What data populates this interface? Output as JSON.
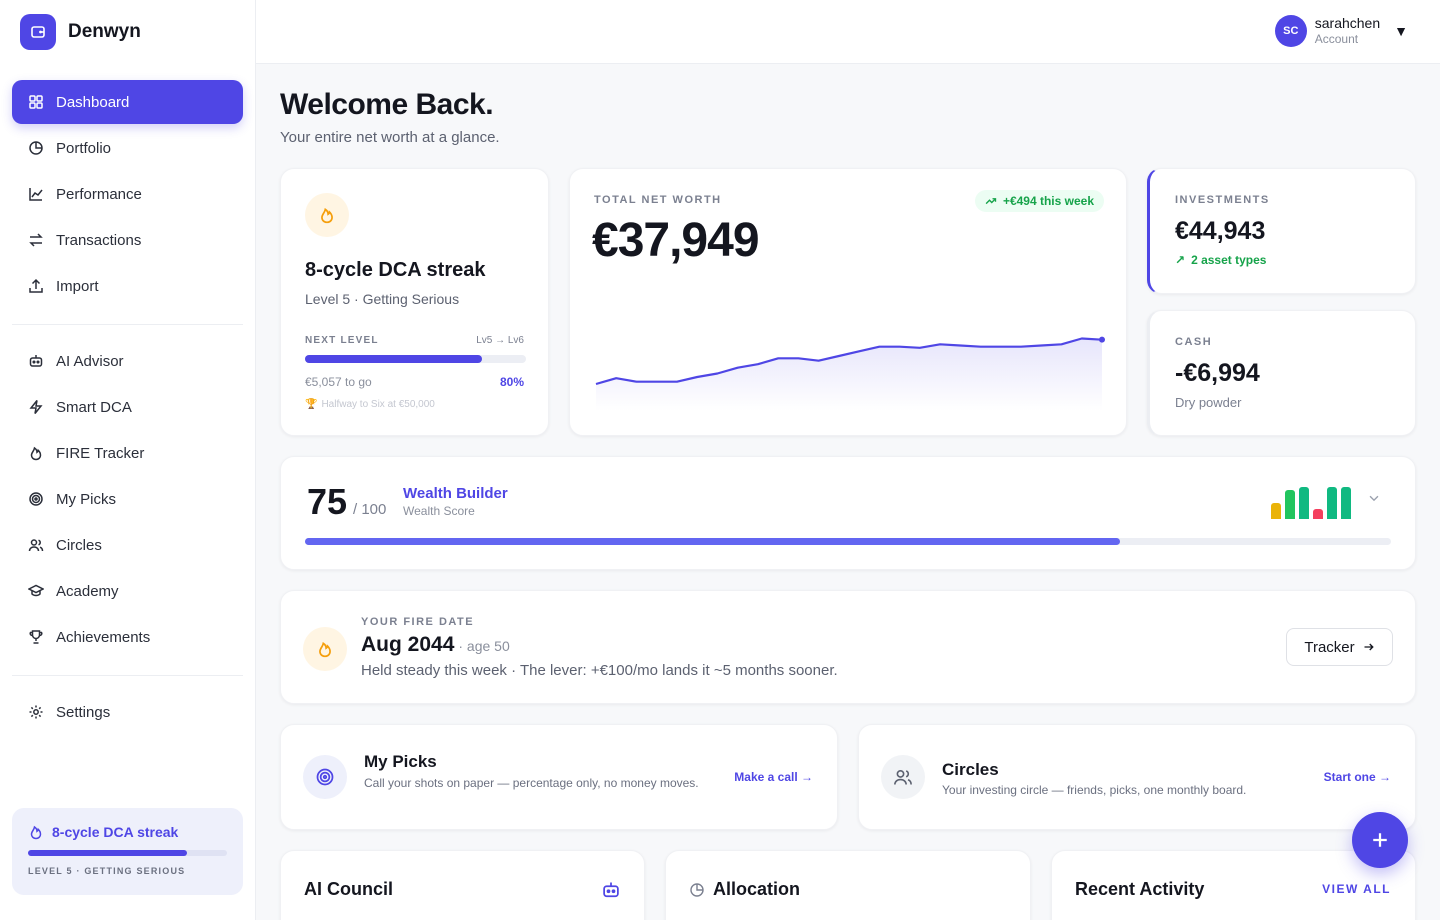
{
  "brand": {
    "name": "Denwyn"
  },
  "nav": [
    {
      "label": "Dashboard",
      "icon": "grid-icon",
      "active": true
    },
    {
      "label": "Portfolio",
      "icon": "pie-icon"
    },
    {
      "label": "Performance",
      "icon": "chart-icon"
    },
    {
      "label": "Transactions",
      "icon": "swap-icon"
    },
    {
      "label": "Import",
      "icon": "upload-icon"
    },
    {
      "label": "AI Advisor",
      "icon": "robot-icon"
    },
    {
      "label": "Smart DCA",
      "icon": "bolt-icon"
    },
    {
      "label": "FIRE Tracker",
      "icon": "flame-icon"
    },
    {
      "label": "My Picks",
      "icon": "target-icon"
    },
    {
      "label": "Circles",
      "icon": "users-icon"
    },
    {
      "label": "Academy",
      "icon": "graduation-icon"
    },
    {
      "label": "Achievements",
      "icon": "trophy-icon"
    },
    {
      "label": "Settings",
      "icon": "gear-icon"
    }
  ],
  "sidebar_streak": {
    "title": "8-cycle DCA streak",
    "sub": "LEVEL 5 · GETTING SERIOUS",
    "progress": 0.8
  },
  "user": {
    "initials": "SC",
    "name": "sarahchen",
    "sub": "Account"
  },
  "page": {
    "title": "Welcome Back.",
    "subtitle": "Your entire net worth at a glance."
  },
  "streak_card": {
    "title": "8-cycle DCA streak",
    "sub": "Level 5 · Getting Serious",
    "next_label": "NEXT LEVEL",
    "levels": "Lv5 → Lv6",
    "to_go": "€5,057 to go",
    "percent": "80%",
    "progress": 0.8,
    "milestone": "Halfway to Six at €50,000"
  },
  "networth": {
    "label": "TOTAL NET WORTH",
    "value": "€37,949",
    "badge": "+€494 this week",
    "spark": [
      18,
      23,
      20,
      20,
      20,
      24,
      27,
      32,
      35,
      40,
      40,
      38,
      42,
      46,
      50,
      50,
      49,
      52,
      51,
      50,
      50,
      50,
      51,
      52,
      57,
      56
    ]
  },
  "investments": {
    "label": "INVESTMENTS",
    "value": "€44,943",
    "sub": "2 asset types"
  },
  "cash": {
    "label": "CASH",
    "value": "-€6,994",
    "sub": "Dry powder"
  },
  "score": {
    "value": "75",
    "max": "/ 100",
    "title": "Wealth Builder",
    "sub": "Wealth Score",
    "progress": 0.75,
    "bars": [
      {
        "value": 0.5,
        "color": "#eab308"
      },
      {
        "value": 0.9,
        "color": "#22c55e"
      },
      {
        "value": 1.0,
        "color": "#10b981"
      },
      {
        "value": 0.3,
        "color": "#f43f5e"
      },
      {
        "value": 1.0,
        "color": "#10b981"
      },
      {
        "value": 1.0,
        "color": "#10b981"
      }
    ]
  },
  "fire": {
    "label": "YOUR FIRE DATE",
    "date": "Aug 2044",
    "age": "· age 50",
    "desc": "Held steady this week · The lever: +€100/mo lands it ~5 months sooner.",
    "button": "Tracker"
  },
  "picks": {
    "title": "My Picks",
    "desc": "Call your shots on paper — percentage only, no money moves.",
    "action": "Make a call →"
  },
  "circles": {
    "title": "Circles",
    "desc": "Your investing circle — friends, picks, one monthly board.",
    "action": "Start one →"
  },
  "bottom": {
    "council": "AI Council",
    "allocation": "Allocation",
    "activity": "Recent Activity",
    "view_all": "VIEW ALL"
  },
  "colors": {
    "accent": "#4f46e5",
    "positive": "#16a34a"
  }
}
